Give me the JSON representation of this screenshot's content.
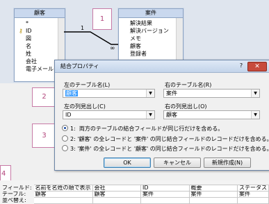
{
  "colors": {
    "callout_border": "#c77aa6",
    "callout_text": "#b2457c",
    "dialog_border": "#6b84a6",
    "selection": "#3399ff"
  },
  "callouts": [
    "1",
    "2",
    "3",
    "4"
  ],
  "table_left": {
    "title": "顧客",
    "fields": [
      "*",
      "ID",
      "図",
      "名",
      "姓",
      "会社",
      "電子メール"
    ],
    "key_icon": "key-icon"
  },
  "table_right": {
    "title": "案件",
    "fields": [
      "解決結果",
      "解決バージョン",
      "メモ",
      "顧客",
      "登録者"
    ]
  },
  "relationship": {
    "one_label": "1",
    "many_label": "∞"
  },
  "dialog": {
    "title": "結合プロパティ",
    "help": "?",
    "close": "✕",
    "left_table_label": "左のテーブル名(L)",
    "left_table_value": "顧客",
    "right_table_label": "右のテーブル名(R)",
    "right_table_value": "案件",
    "left_column_label": "左の列見出し(C)",
    "left_column_value": "ID",
    "right_column_label": "右の列見出し(O)",
    "right_column_value": "顧客",
    "options": [
      {
        "num": "1:",
        "text": "両方のテーブルの結合フィールドが同じ行だけを含める。",
        "selected": true
      },
      {
        "num": "2:",
        "text": "'顧客' の全レコードと '案件' の同じ結合フィールドのレコードだけを含める。",
        "selected": false
      },
      {
        "num": "3:",
        "text": "'案件' の全レコードと '顧客' の同じ結合フィールドのレコードだけを含める。",
        "selected": false
      }
    ],
    "ok": "OK",
    "cancel": "キャンセル",
    "new_join": "新規作成(N)"
  },
  "grid": {
    "row_labels": [
      "フィールド:",
      "テーブル:",
      "並べ替え:"
    ],
    "columns": [
      {
        "field": "名前を名姓の順で表示",
        "table": "顧客"
      },
      {
        "field": "会社",
        "table": "顧客"
      },
      {
        "field": "ID",
        "table": "案件"
      },
      {
        "field": "概要",
        "table": "案件"
      },
      {
        "field": "ステータス",
        "table": "案件"
      }
    ]
  }
}
